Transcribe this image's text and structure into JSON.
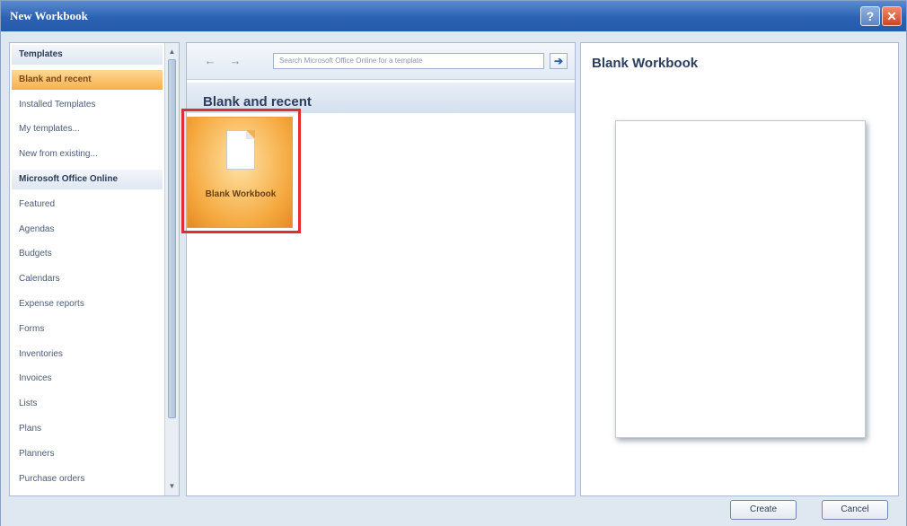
{
  "window": {
    "title": "New Workbook",
    "help_glyph": "?",
    "close_glyph": "✕"
  },
  "sidebar": {
    "items": [
      {
        "label": "Templates",
        "kind": "header"
      },
      {
        "label": "Blank and recent",
        "kind": "selected"
      },
      {
        "label": "Installed Templates",
        "kind": "item"
      },
      {
        "label": "My templates...",
        "kind": "item"
      },
      {
        "label": "New from existing...",
        "kind": "item"
      },
      {
        "label": "Microsoft Office Online",
        "kind": "header"
      },
      {
        "label": "Featured",
        "kind": "item"
      },
      {
        "label": "Agendas",
        "kind": "item"
      },
      {
        "label": "Budgets",
        "kind": "item"
      },
      {
        "label": "Calendars",
        "kind": "item"
      },
      {
        "label": "Expense reports",
        "kind": "item"
      },
      {
        "label": "Forms",
        "kind": "item"
      },
      {
        "label": "Inventories",
        "kind": "item"
      },
      {
        "label": "Invoices",
        "kind": "item"
      },
      {
        "label": "Lists",
        "kind": "item"
      },
      {
        "label": "Plans",
        "kind": "item"
      },
      {
        "label": "Planners",
        "kind": "item"
      },
      {
        "label": "Purchase orders",
        "kind": "item"
      }
    ]
  },
  "toolbar": {
    "back_glyph": "←",
    "forward_glyph": "→",
    "search_placeholder": "Search Microsoft Office Online for a template",
    "go_glyph": "➔"
  },
  "main": {
    "section_title": "Blank and recent",
    "tile_label": "Blank Workbook"
  },
  "preview": {
    "title": "Blank Workbook"
  },
  "footer": {
    "create_label": "Create",
    "cancel_label": "Cancel"
  },
  "colors": {
    "titlebar": "#2c62b3",
    "selected": "#f6b04b",
    "highlight": "#e02e2e"
  }
}
